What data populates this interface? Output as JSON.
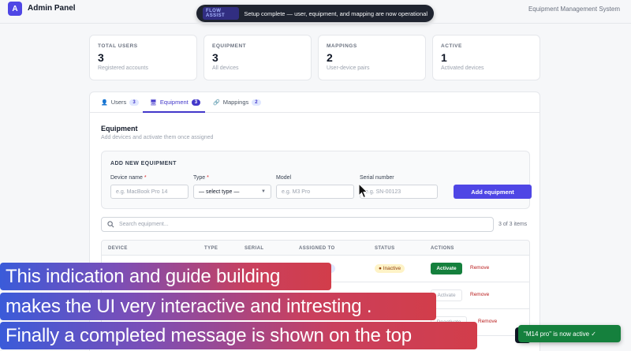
{
  "header": {
    "logo_letter": "A",
    "app_title": "Admin Panel",
    "system_title": "Equipment Management System"
  },
  "top_toast": {
    "tag": "FLOW ASSIST",
    "message": "Setup complete — user, equipment, and mapping are now operational"
  },
  "stats": [
    {
      "label": "TOTAL USERS",
      "value": "3",
      "sub": "Registered accounts"
    },
    {
      "label": "EQUIPMENT",
      "value": "3",
      "sub": "All devices"
    },
    {
      "label": "MAPPINGS",
      "value": "2",
      "sub": "User-device pairs"
    },
    {
      "label": "ACTIVE",
      "value": "1",
      "sub": "Activated devices"
    }
  ],
  "tabs": [
    {
      "icon": "user-icon",
      "label": "Users",
      "count": "3"
    },
    {
      "icon": "monitor-icon",
      "label": "Equipment",
      "count": "3"
    },
    {
      "icon": "link-icon",
      "label": "Mappings",
      "count": "2"
    }
  ],
  "section": {
    "title": "Equipment",
    "subtitle": "Add devices and activate them once assigned"
  },
  "add_form": {
    "header": "ADD NEW EQUIPMENT",
    "device_name_label": "Device name",
    "device_name_placeholder": "e.g. MacBook Pro 14",
    "type_label": "Type",
    "type_value": "— select type —",
    "model_label": "Model",
    "model_placeholder": "e.g. M3 Pro",
    "serial_label": "Serial number",
    "serial_placeholder": "e.g. SN-00123",
    "required_mark": "*",
    "submit_label": "Add equipment"
  },
  "search": {
    "placeholder": "Search equipment...",
    "count_text": "3 of 3 items"
  },
  "table": {
    "headers": [
      "DEVICE",
      "TYPE",
      "SERIAL",
      "ASSIGNED TO",
      "STATUS",
      "ACTIONS"
    ],
    "rows": [
      {
        "assigned": "nson",
        "status": "Inactive",
        "action": "Activate",
        "remove": "Remove"
      },
      {
        "action": "Activate",
        "remove": "Remove"
      },
      {
        "action": "Deactivate",
        "remove": "Remove"
      }
    ]
  },
  "captions": [
    "This indication and guide building",
    " makes the UI very interactive and intresting .",
    "Finally a completed message is shown on the top"
  ],
  "bottom_toast": {
    "message": "\"M14 pro\" is now active ✓"
  }
}
